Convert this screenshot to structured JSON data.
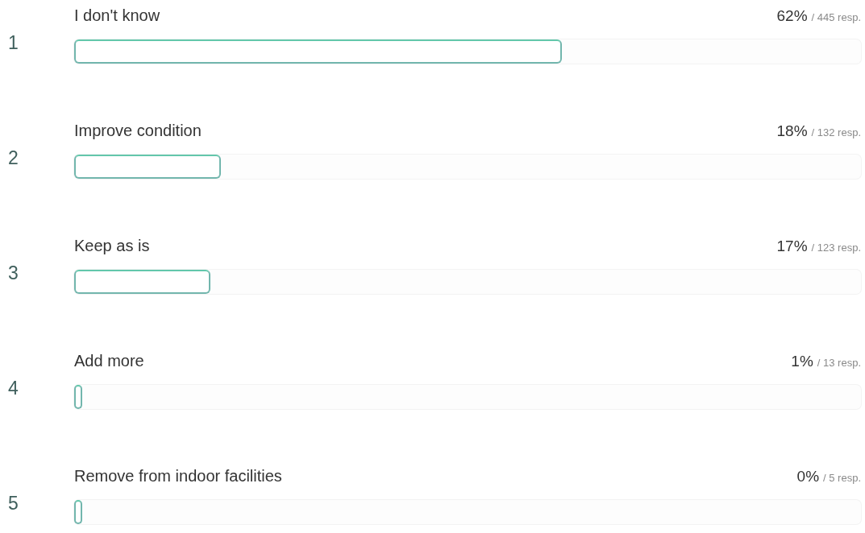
{
  "answers": [
    {
      "number": "1",
      "label": "I don't know",
      "percent": "62%",
      "responses": "/ 445 resp.",
      "level": 0.62
    },
    {
      "number": "2",
      "label": "Improve condition",
      "percent": "18%",
      "responses": "/ 132 resp.",
      "level": 0.186
    },
    {
      "number": "3",
      "label": "Keep as is",
      "percent": "17%",
      "responses": "/ 123 resp.",
      "level": 0.173
    },
    {
      "number": "4",
      "label": "Add more",
      "percent": "1%",
      "responses": "/ 13 resp.",
      "level": 0.01
    },
    {
      "number": "5",
      "label": "Remove from indoor facilities",
      "percent": "0%",
      "responses": "/ 5 resp.",
      "level": 0.0
    }
  ]
}
